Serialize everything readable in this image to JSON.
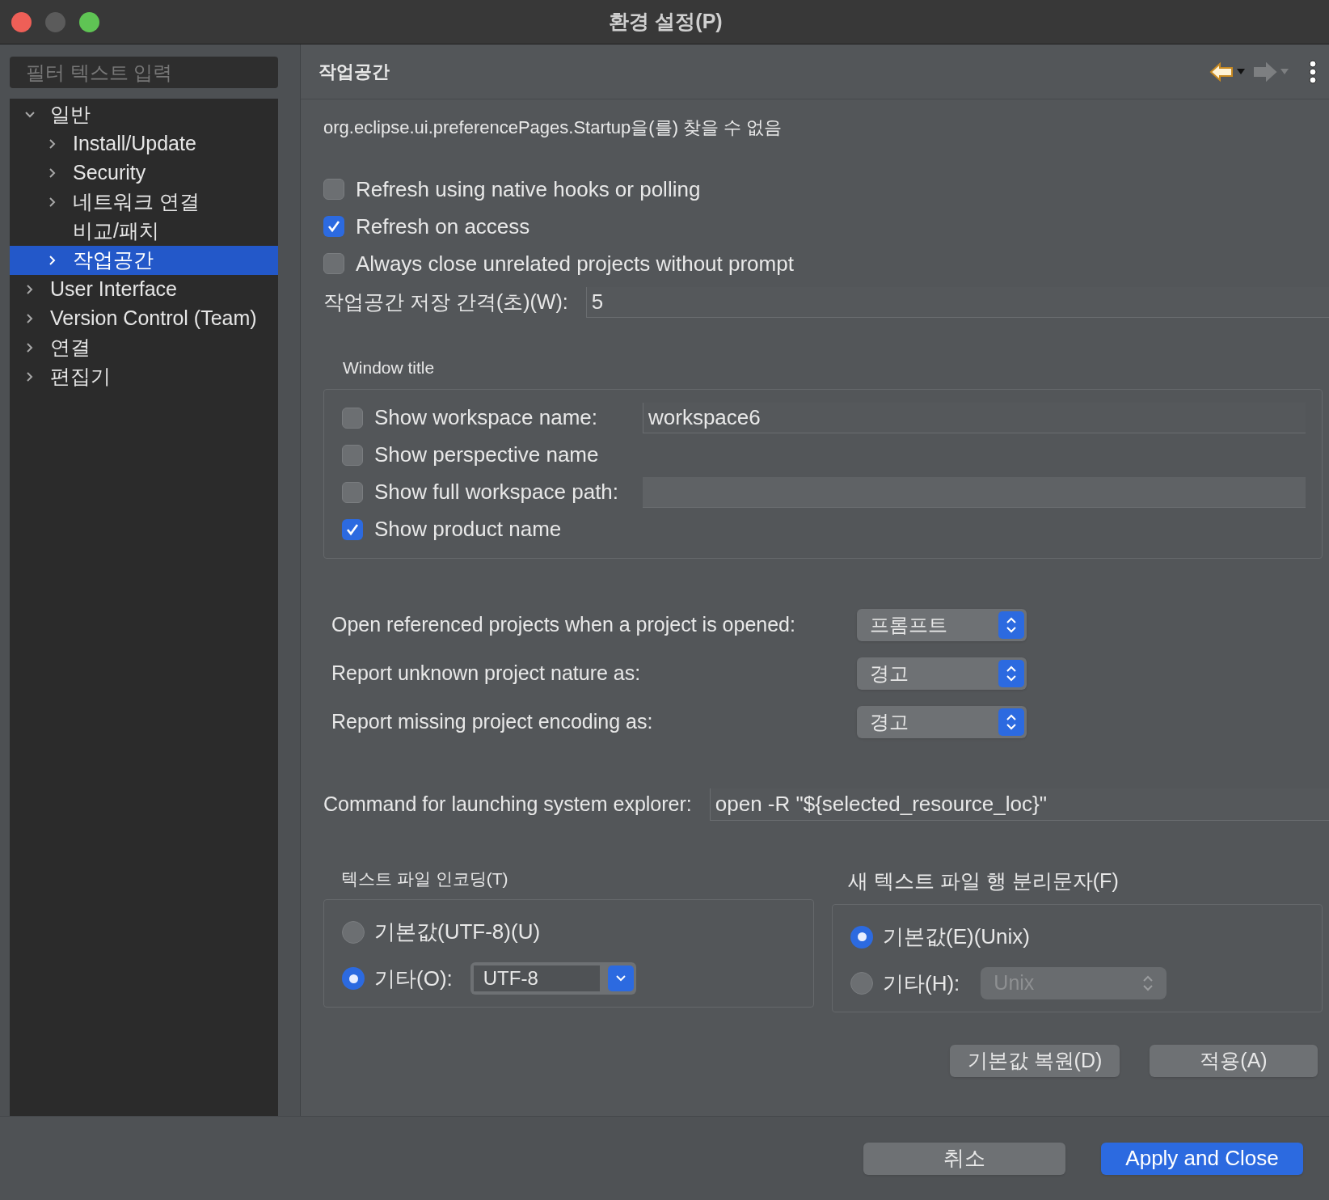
{
  "window": {
    "title": "환경 설정(P)"
  },
  "sidebar": {
    "filter_placeholder": "필터 텍스트 입력",
    "tree": [
      {
        "label": "일반",
        "kind": "folder",
        "expanded": true,
        "selected": false,
        "children": [
          {
            "label": "Install/Update",
            "kind": "folder",
            "expanded": false,
            "selected": false
          },
          {
            "label": "Security",
            "kind": "folder",
            "expanded": false,
            "selected": false
          },
          {
            "label": "네트워크 연결",
            "kind": "folder",
            "expanded": false,
            "selected": false
          },
          {
            "label": "비교/패치",
            "kind": "leaf",
            "selected": false
          },
          {
            "label": "작업공간",
            "kind": "folder",
            "expanded": false,
            "selected": true
          }
        ]
      },
      {
        "label": "User Interface",
        "kind": "folder",
        "expanded": false,
        "selected": false
      },
      {
        "label": "Version Control (Team)",
        "kind": "folder",
        "expanded": false,
        "selected": false
      },
      {
        "label": "연결",
        "kind": "folder",
        "expanded": false,
        "selected": false
      },
      {
        "label": "편집기",
        "kind": "folder",
        "expanded": false,
        "selected": false
      }
    ]
  },
  "page": {
    "title": "작업공간",
    "back_enabled": true,
    "forward_enabled": false
  },
  "message": "org.eclipse.ui.preferencePages.Startup을(를) 찾을 수 없음",
  "options": [
    {
      "label": "Refresh using native hooks or polling",
      "checked": false
    },
    {
      "label": "Refresh on access",
      "checked": true
    },
    {
      "label": "Always close unrelated projects without prompt",
      "checked": false
    }
  ],
  "save_interval": {
    "label": "작업공간 저장 간격(초)(W):",
    "value": "5"
  },
  "window_title": {
    "title": "Window title",
    "rows": [
      {
        "kind": "field",
        "label": "Show workspace name:",
        "checked": false,
        "value": "workspace6"
      },
      {
        "kind": "plain",
        "label": "Show perspective name",
        "checked": false
      },
      {
        "kind": "field",
        "label": "Show full workspace path:",
        "checked": false
      },
      {
        "kind": "plain",
        "label": "Show product name",
        "checked": true
      }
    ]
  },
  "dropdowns": [
    {
      "label": "Open referenced projects when a project is opened:",
      "value": "프롬프트"
    },
    {
      "label": "Report unknown project nature as:",
      "value": "경고"
    },
    {
      "label": "Report missing project encoding as:",
      "value": "경고"
    }
  ],
  "explorer": {
    "label": "Command for launching system explorer:",
    "value": "open -R \"${selected_resource_loc}\""
  },
  "groups": [
    {
      "title": "텍스트 파일 인코딩(T)",
      "options": [
        {
          "kind": "plain",
          "label": "기본값(UTF-8)(U)",
          "selected": false
        },
        {
          "kind": "combo",
          "label": "기타(O):",
          "selected": true,
          "value": "UTF-8",
          "disabled": false
        }
      ]
    },
    {
      "title": "새 텍스트 파일 행 분리문자(F)",
      "options": [
        {
          "kind": "plain",
          "label": "기본값(E)(Unix)",
          "selected": true
        },
        {
          "kind": "combo",
          "label": "기타(H):",
          "selected": false,
          "value": "Unix",
          "disabled": true
        }
      ]
    }
  ],
  "page_buttons": [
    "기본값 복원(D)",
    "적용(A)"
  ],
  "dialog_buttons": [
    {
      "label": "취소",
      "primary": false
    },
    {
      "label": "Apply and Close",
      "primary": true
    }
  ]
}
